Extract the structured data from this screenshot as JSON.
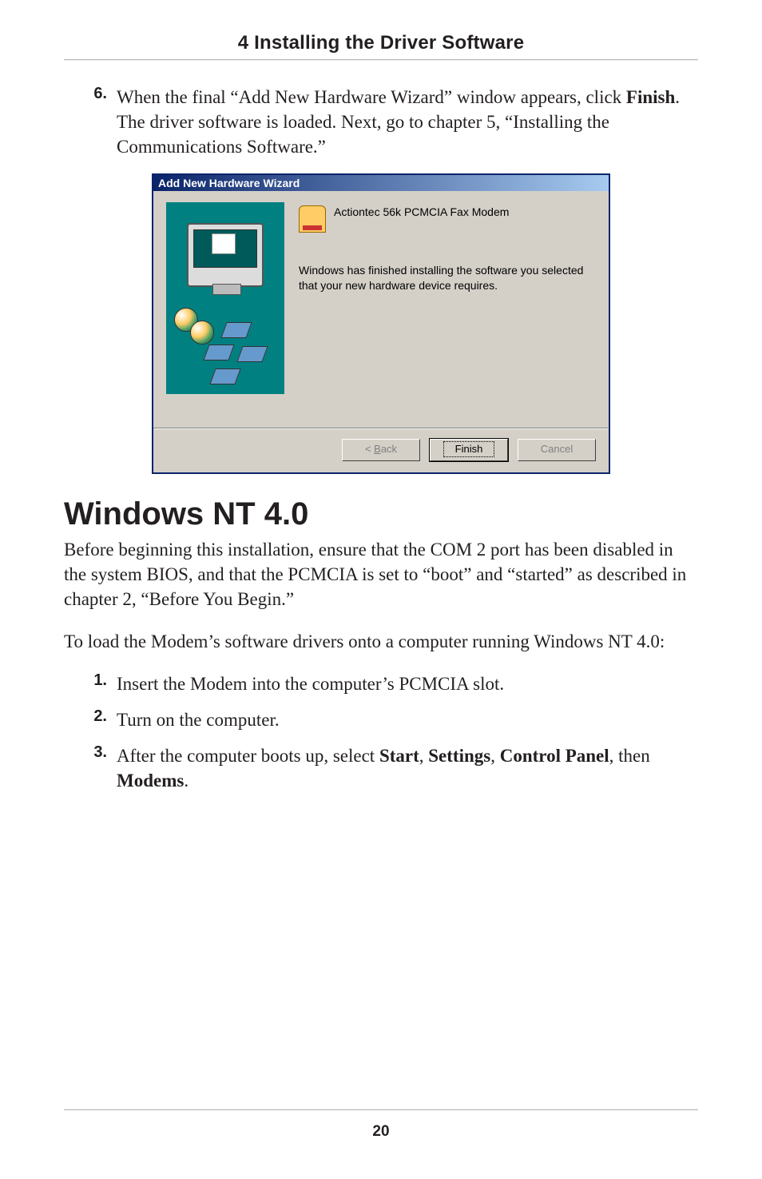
{
  "header": {
    "chapter_title": "4 Installing the Driver Software"
  },
  "step6": {
    "number": "6.",
    "text_before_bold": "When the final “Add New Hardware Wizard” window appears, click ",
    "bold": "Finish",
    "text_after_bold": ". The driver software is loaded. Next, go to chapter 5, “Installing the Communications Software.”"
  },
  "wizard": {
    "title": "Add New Hardware Wizard",
    "device_name": "Actiontec 56k PCMCIA Fax Modem",
    "message": "Windows has finished installing the software you selected that your new hardware device requires.",
    "buttons": {
      "back_prefix": "< ",
      "back_accel": "B",
      "back_suffix": "ack",
      "finish": "Finish",
      "cancel": "Cancel"
    }
  },
  "section": {
    "title": "Windows NT 4.0",
    "intro": "Before beginning this installation, ensure that the COM 2 port has been disabled in the system BIOS, and that the PCMCIA is set to “boot” and “started” as described in chapter 2, “Before You Begin.”",
    "lead": "To load the Modem’s software drivers onto a computer running Windows NT 4.0:"
  },
  "steps": {
    "s1": {
      "number": "1.",
      "text": "Insert the Modem into the computer’s PCMCIA slot."
    },
    "s2": {
      "number": "2.",
      "text": "Turn on the computer."
    },
    "s3": {
      "number": "3.",
      "prefix": "After the computer boots up,  select ",
      "b1": "Start",
      "sep": ", ",
      "b2": "Settings",
      "b3": "Control Panel",
      "after": ", then ",
      "b4": "Modems",
      "end": "."
    }
  },
  "footer": {
    "page_number": "20"
  }
}
